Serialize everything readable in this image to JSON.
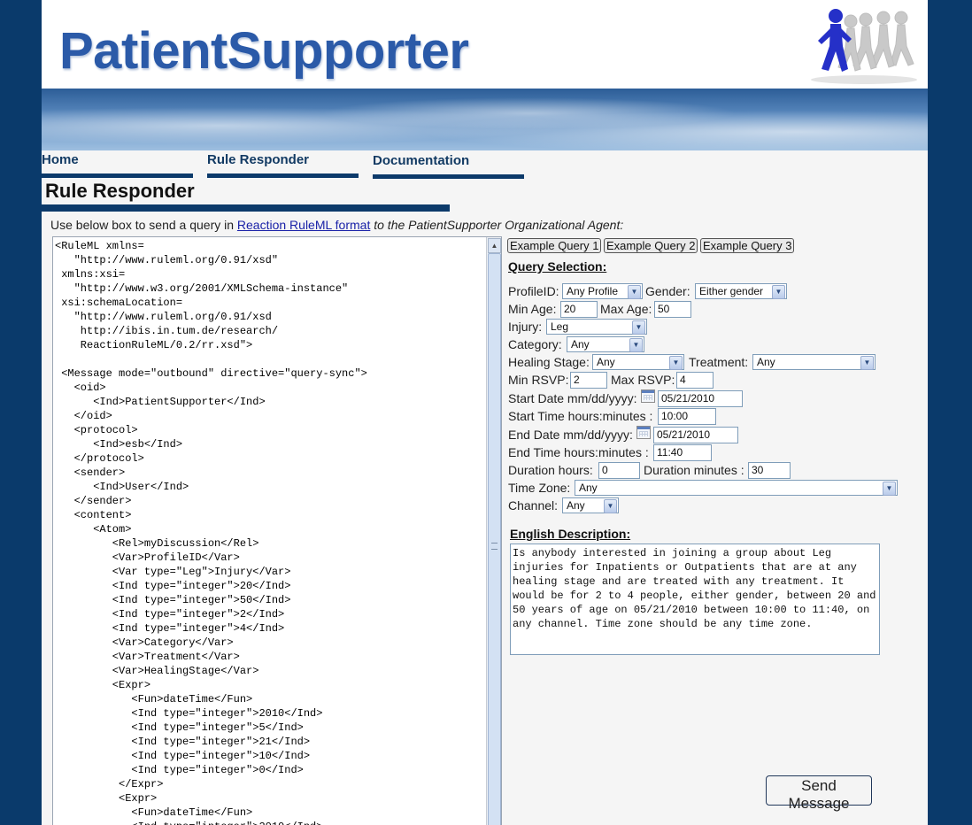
{
  "header": {
    "logo_text": "PatientSupporter"
  },
  "nav": {
    "items": [
      {
        "label": "Home"
      },
      {
        "label": "Rule Responder"
      },
      {
        "label": "Documentation"
      }
    ]
  },
  "page_title": "Rule Responder",
  "intro": {
    "before": "Use below box to send a query in ",
    "link": "Reaction RuleML format",
    "after": " to the PatientSupporter Organizational Agent:"
  },
  "editor": {
    "code": "<RuleML xmlns=\n   \"http://www.ruleml.org/0.91/xsd\"\n xmlns:xsi=\n   \"http://www.w3.org/2001/XMLSchema-instance\"\n xsi:schemaLocation=\n   \"http://www.ruleml.org/0.91/xsd\n    http://ibis.in.tum.de/research/\n    ReactionRuleML/0.2/rr.xsd\">\n\n <Message mode=\"outbound\" directive=\"query-sync\">\n   <oid>\n      <Ind>PatientSupporter</Ind>\n   </oid>\n   <protocol>\n      <Ind>esb</Ind>\n   </protocol>\n   <sender>\n      <Ind>User</Ind>\n   </sender>\n   <content>\n      <Atom>\n         <Rel>myDiscussion</Rel>\n         <Var>ProfileID</Var>\n         <Var type=\"Leg\">Injury</Var>\n         <Ind type=\"integer\">20</Ind>\n         <Ind type=\"integer\">50</Ind>\n         <Ind type=\"integer\">2</Ind>\n         <Ind type=\"integer\">4</Ind>\n         <Var>Category</Var>\n         <Var>Treatment</Var>\n         <Var>HealingStage</Var>\n         <Expr>\n            <Fun>dateTime</Fun>\n            <Ind type=\"integer\">2010</Ind>\n            <Ind type=\"integer\">5</Ind>\n            <Ind type=\"integer\">21</Ind>\n            <Ind type=\"integer\">10</Ind>\n            <Ind type=\"integer\">0</Ind>\n          </Expr>\n          <Expr>\n            <Fun>dateTime</Fun>\n            <Ind type=\"integer\">2010</Ind>"
  },
  "examples": {
    "q1": "Example Query 1",
    "q2": "Example Query 2",
    "q3": "Example Query 3"
  },
  "query": {
    "heading": "Query Selection:",
    "profile_label": "ProfileID:",
    "profile_value": "Any Profile",
    "gender_label": "Gender:",
    "gender_value": "Either gender",
    "min_age_label": "Min Age:",
    "min_age_value": "20",
    "max_age_label": "Max Age:",
    "max_age_value": "50",
    "injury_label": "Injury:",
    "injury_value": "Leg",
    "category_label": "Category:",
    "category_value": "Any",
    "healing_label": "Healing Stage:",
    "healing_value": "Any",
    "treatment_label": "Treatment:",
    "treatment_value": "Any",
    "min_rsvp_label": "Min RSVP:",
    "min_rsvp_value": "2",
    "max_rsvp_label": "Max RSVP:",
    "max_rsvp_value": "4",
    "start_date_label": "Start Date mm/dd/yyyy:",
    "start_date_value": "05/21/2010",
    "start_time_label": "Start Time hours:minutes :",
    "start_time_value": "10:00",
    "end_date_label": "End Date mm/dd/yyyy:",
    "end_date_value": "05/21/2010",
    "end_time_label": "End Time hours:minutes :",
    "end_time_value": "11:40",
    "dur_hours_label": "Duration hours:",
    "dur_hours_value": "0",
    "dur_minutes_label": "Duration minutes :",
    "dur_minutes_value": "30",
    "timezone_label": "Time Zone:",
    "timezone_value": "Any",
    "channel_label": "Channel:",
    "channel_value": "Any"
  },
  "description": {
    "heading": "English Description:",
    "text": "Is anybody interested in joining a group about Leg injuries for Inpatients or Outpatients that are at any healing stage and are treated with any treatment. It would be for 2 to 4 people, either gender, between 20 and 50 years of age on 05/21/2010 between 10:00 to 11:40, on any channel. Time zone should be any time zone."
  },
  "send_label": "Send Message"
}
